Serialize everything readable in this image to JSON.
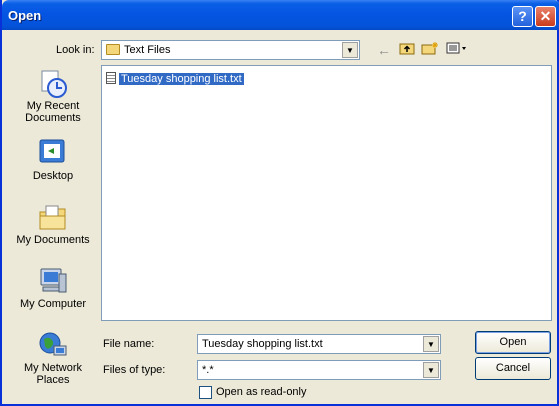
{
  "window": {
    "title": "Open",
    "help_glyph": "?",
    "close_glyph": "✕"
  },
  "lookin": {
    "label": "Look in:",
    "value": "Text Files"
  },
  "toolbar": {
    "back": "←",
    "up": "up-folder-icon",
    "newfolder": "new-folder-icon",
    "views": "views-icon"
  },
  "places": [
    {
      "label": "My Recent Documents"
    },
    {
      "label": "Desktop"
    },
    {
      "label": "My Documents"
    },
    {
      "label": "My Computer"
    },
    {
      "label": "My Network Places"
    }
  ],
  "files": [
    {
      "name": "Tuesday shopping list.txt",
      "selected": true
    }
  ],
  "filename": {
    "label": "File name:",
    "value": "Tuesday shopping list.txt"
  },
  "filetype": {
    "label": "Files of type:",
    "value": "*.*"
  },
  "readonly": {
    "label": "Open as read-only"
  },
  "buttons": {
    "open": "Open",
    "cancel": "Cancel"
  }
}
